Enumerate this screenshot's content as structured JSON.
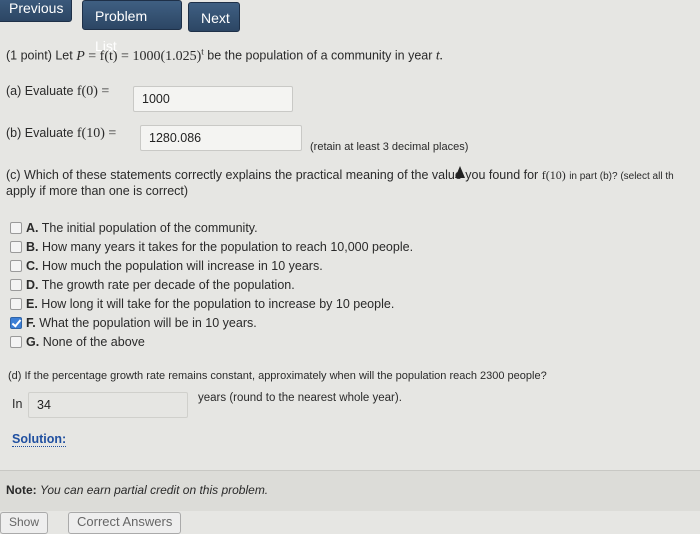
{
  "nav": {
    "previous": "Previous",
    "problem_list": "Problem List",
    "next": "Next"
  },
  "problem": {
    "points": "(1 point)",
    "intro_let": "Let",
    "intro_P": "P",
    "intro_eq": "= f(t) = 1000(1.025)",
    "intro_exp": "t",
    "intro_rest": "be the population of a community in year",
    "intro_t": "t."
  },
  "part_a": {
    "label": "(a) Evaluate",
    "expr": "f(0) =",
    "answer": "1000"
  },
  "part_b": {
    "label": "(b) Evaluate",
    "expr": "f(10) =",
    "answer": "1280.086",
    "hint": "(retain at least 3 decimal places)"
  },
  "part_c": {
    "line1_a": "(c) Which of these statements correctly explains the practical meaning of the value you found for",
    "line1_expr": "f(10)",
    "line1_b": "in part (b)? (select all th",
    "line2": "apply if more than one is correct)",
    "choices": [
      {
        "letter": "A.",
        "text": "The initial population of the community.",
        "checked": false
      },
      {
        "letter": "B.",
        "text": "How many years it takes for the population to reach 10,000 people.",
        "checked": false
      },
      {
        "letter": "C.",
        "text": "How much the population will increase in 10 years.",
        "checked": false
      },
      {
        "letter": "D.",
        "text": "The growth rate per decade of the population.",
        "checked": false
      },
      {
        "letter": "E.",
        "text": "How long it will take for the population to increase by 10 people.",
        "checked": false
      },
      {
        "letter": "F.",
        "text": "What the population will be in 10 years.",
        "checked": true
      },
      {
        "letter": "G.",
        "text": "None of the above",
        "checked": false
      }
    ]
  },
  "part_d": {
    "question": "(d) If the percentage growth rate remains constant, approximately when will the population reach 2300 people?",
    "prefix": "In",
    "answer": "34",
    "suffix": "years (round to the nearest whole year)."
  },
  "solution_label": "Solution:",
  "note": {
    "label": "Note:",
    "text": "You can earn partial credit on this problem."
  },
  "bottom": {
    "show": "Show",
    "correct_answers": "Correct Answers"
  },
  "colors": {
    "nav_button": "#2c4664",
    "checkbox_checked": "#3c7fd6",
    "solution_link": "#1f4fa0"
  }
}
